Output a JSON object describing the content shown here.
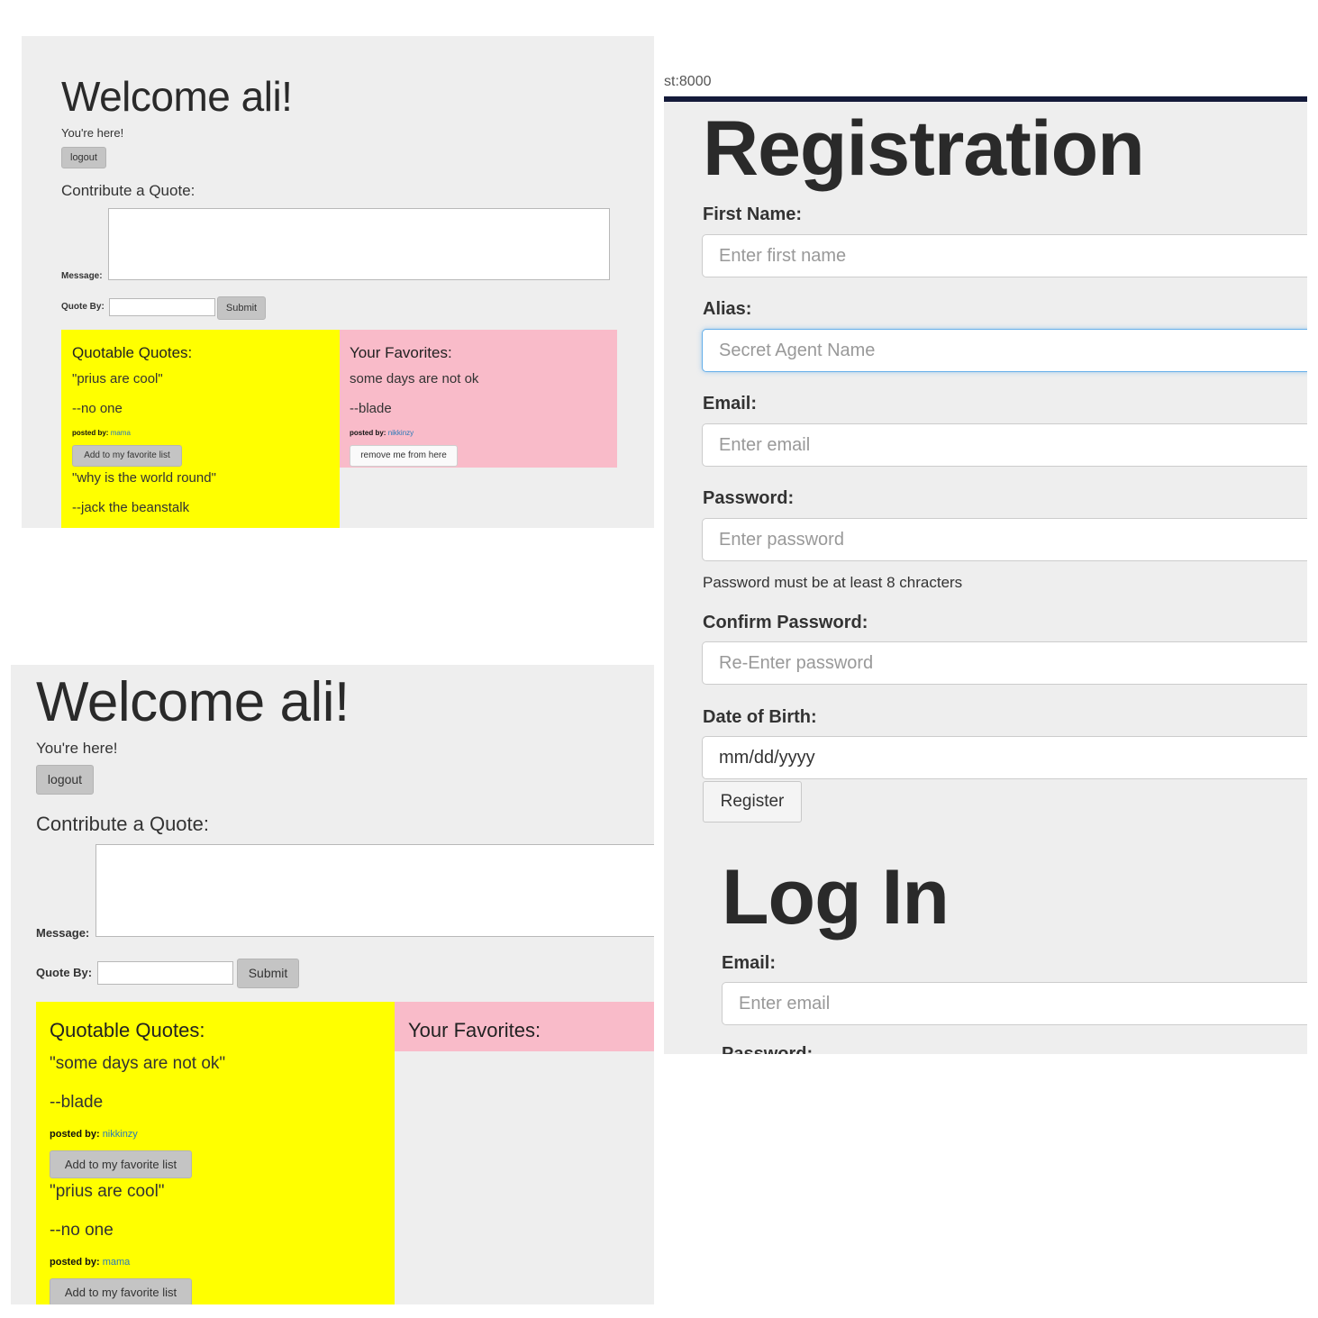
{
  "panel1": {
    "welcome": "Welcome ali!",
    "youre_here": "You're here!",
    "logout": "logout",
    "contribute": "Contribute a Quote:",
    "message_label": "Message:",
    "quote_by_label": "Quote By:",
    "submit": "Submit",
    "quotable_title": "Quotable Quotes:",
    "quotes": [
      {
        "text": "\"prius are cool\"",
        "author": "--no one",
        "posted_label": "posted by:",
        "user": "mama",
        "button": "Add to my favorite list"
      },
      {
        "text": "\"why is the world round\"",
        "author": "--jack the beanstalk"
      }
    ],
    "favorites_title": "Your Favorites:",
    "favorites": [
      {
        "text": "some days are not ok",
        "author": "--blade",
        "posted_label": "posted by:",
        "user": "nikkinzy",
        "button": "remove me from here"
      }
    ]
  },
  "panel2": {
    "welcome": "Welcome ali!",
    "youre_here": "You're here!",
    "logout": "logout",
    "contribute": "Contribute a Quote:",
    "message_label": "Message:",
    "quote_by_label": "Quote By:",
    "submit": "Submit",
    "quotable_title": "Quotable Quotes:",
    "quotes": [
      {
        "text": "\"some days are not ok\"",
        "author": "--blade",
        "posted_label": "posted by:",
        "user": "nikkinzy",
        "button": "Add to my favorite list"
      },
      {
        "text": "\"prius are cool\"",
        "author": "--no one",
        "posted_label": "posted by:",
        "user": "mama",
        "button": "Add to my favorite list"
      }
    ],
    "favorites_title": "Your Favorites:"
  },
  "registration": {
    "url_fragment": "st:8000",
    "title": "Registration",
    "first_name_label": "First Name:",
    "first_name_placeholder": "Enter first name",
    "alias_label": "Alias:",
    "alias_placeholder": "Secret Agent Name",
    "email_label": "Email:",
    "email_placeholder": "Enter email",
    "password_label": "Password:",
    "password_placeholder": "Enter password",
    "password_hint": "Password must be at least 8 chracters",
    "confirm_label": "Confirm Password:",
    "confirm_placeholder": "Re-Enter password",
    "dob_label": "Date of Birth:",
    "dob_value": "mm/dd/yyyy",
    "register_button": "Register",
    "login_title": "Log In",
    "login_email_label": "Email:",
    "login_email_placeholder": "Enter email",
    "login_password_label": "Password:"
  },
  "colors": {
    "panel_bg": "#eeeeee",
    "quotes_bg": "#ffff00",
    "favorites_bg": "#f9bbc9",
    "link": "#2a7ab8",
    "focus": "#66afe9"
  }
}
